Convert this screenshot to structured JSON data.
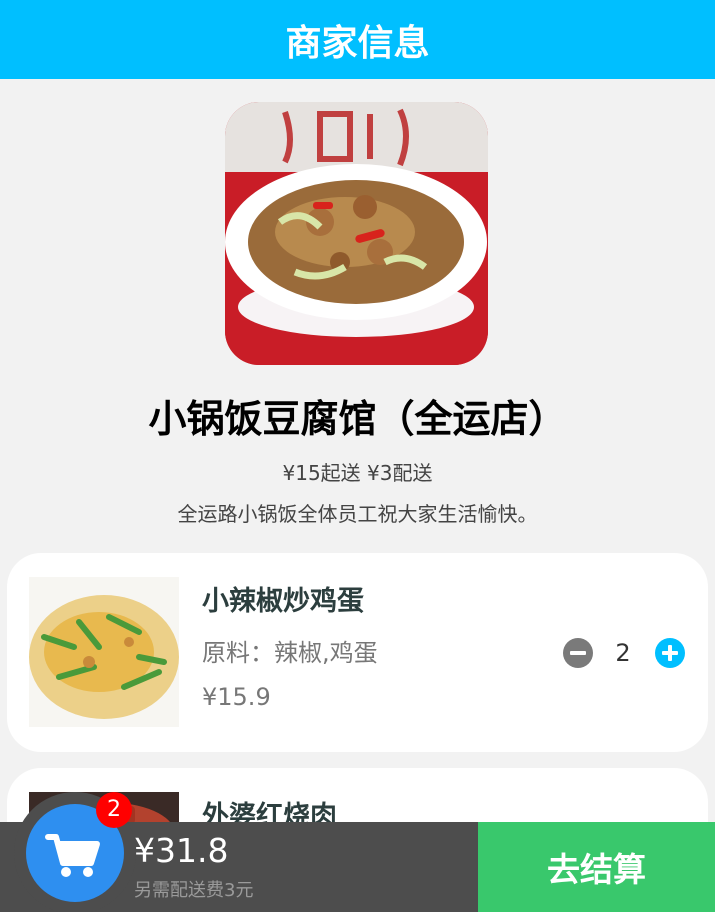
{
  "header": {
    "title": "商家信息"
  },
  "shop": {
    "name": "小锅饭豆腐馆（全运店）",
    "fees": "¥15起送 ¥3配送",
    "notice": "全运路小锅饭全体员工祝大家生活愉快。"
  },
  "items": [
    {
      "name": "小辣椒炒鸡蛋",
      "ingredients": "原料：辣椒,鸡蛋",
      "price": "¥15.9",
      "quantity": "2"
    },
    {
      "name": "外婆红烧肉"
    }
  ],
  "cart": {
    "count": "2",
    "total": "¥31.8",
    "delivery_note": "另需配送费3元",
    "checkout_label": "去结算"
  },
  "colors": {
    "header": "#00bfff",
    "checkout": "#39c86c",
    "cart_button": "#2e8ff0",
    "badge": "#ff0000",
    "bottom_bar": "#4d4d4d"
  }
}
